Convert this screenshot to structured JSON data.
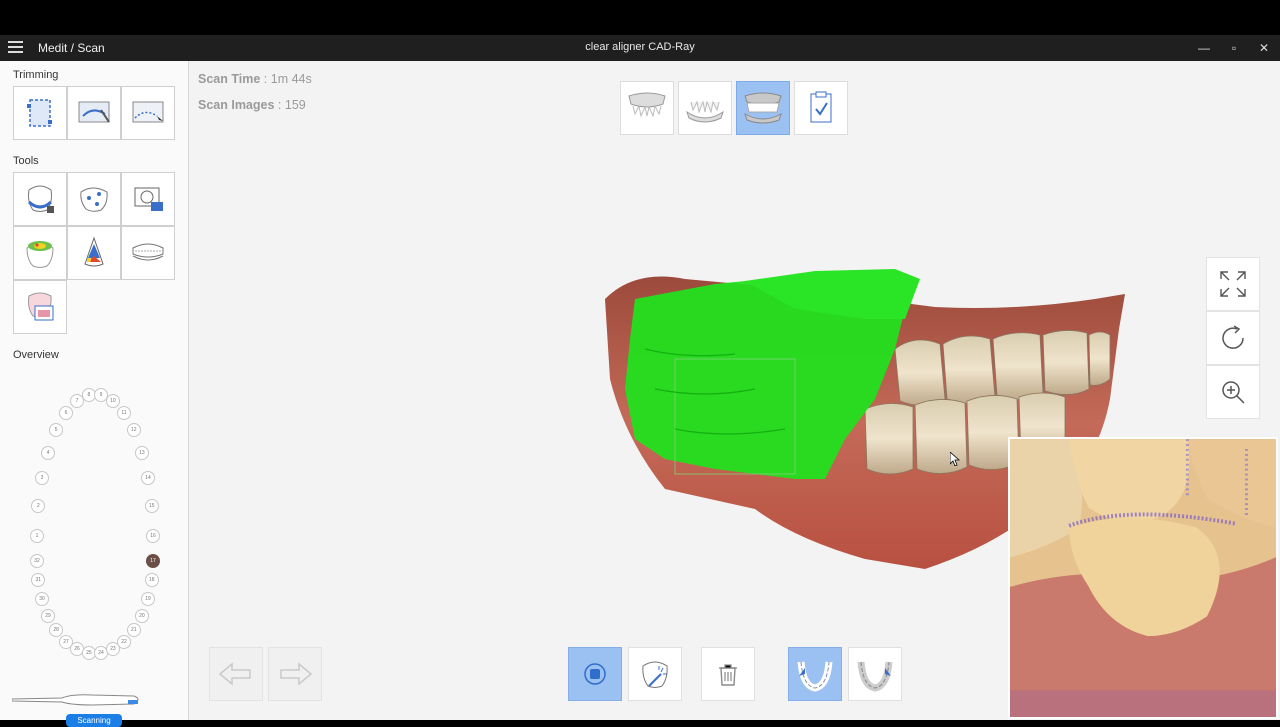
{
  "titlebar": {
    "app_name": "Medit / Scan",
    "window_title": "clear aligner CAD-Ray",
    "minimize": "—",
    "maximize": "▫",
    "close": "✕"
  },
  "sidebar": {
    "trimming_title": "Trimming",
    "tools_title": "Tools",
    "overview_title": "Overview",
    "scanner_status": "Scanning",
    "teeth_upper": [
      "1",
      "2",
      "3",
      "4",
      "5",
      "6",
      "7",
      "8",
      "9",
      "10",
      "11",
      "12",
      "13",
      "14",
      "15",
      "16"
    ],
    "teeth_lower": [
      "17",
      "18",
      "19",
      "20",
      "21",
      "22",
      "23",
      "24",
      "25",
      "26",
      "27",
      "28",
      "29",
      "30",
      "31",
      "32"
    ],
    "active_tooth": "17"
  },
  "viewport": {
    "scan_time_label": "Scan Time",
    "scan_time_value": ": 1m 44s",
    "scan_images_label": "Scan Images",
    "scan_images_value": ": 159"
  },
  "colors": {
    "accent": "#1a7ee6",
    "active_button": "#9bc0f2",
    "scan_overlay": "#22e01e",
    "gum": "#b85a4a",
    "tooth": "#e7d9bf"
  }
}
